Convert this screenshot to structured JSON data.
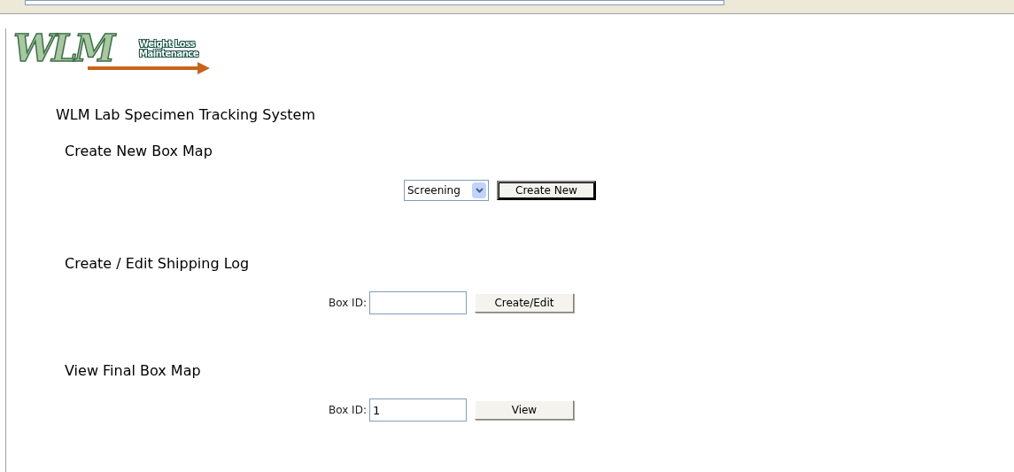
{
  "logo": {
    "mark": "WLM",
    "tagline": [
      "Weight Loss",
      "Maintenance"
    ]
  },
  "title": "WLM Lab Specimen Tracking System",
  "sections": [
    {
      "kind": "select",
      "heading": "Create New Box Map",
      "value": "Screening",
      "button": "Create New",
      "focused": true
    },
    {
      "kind": "input",
      "heading": "Create / Edit Shipping Log",
      "label": "Box ID:",
      "button": "Create/Edit",
      "focused": false
    },
    {
      "kind": "input",
      "heading": "View Final Box Map",
      "label": "Box ID:",
      "value": "1",
      "button": "View",
      "focused": false
    }
  ]
}
